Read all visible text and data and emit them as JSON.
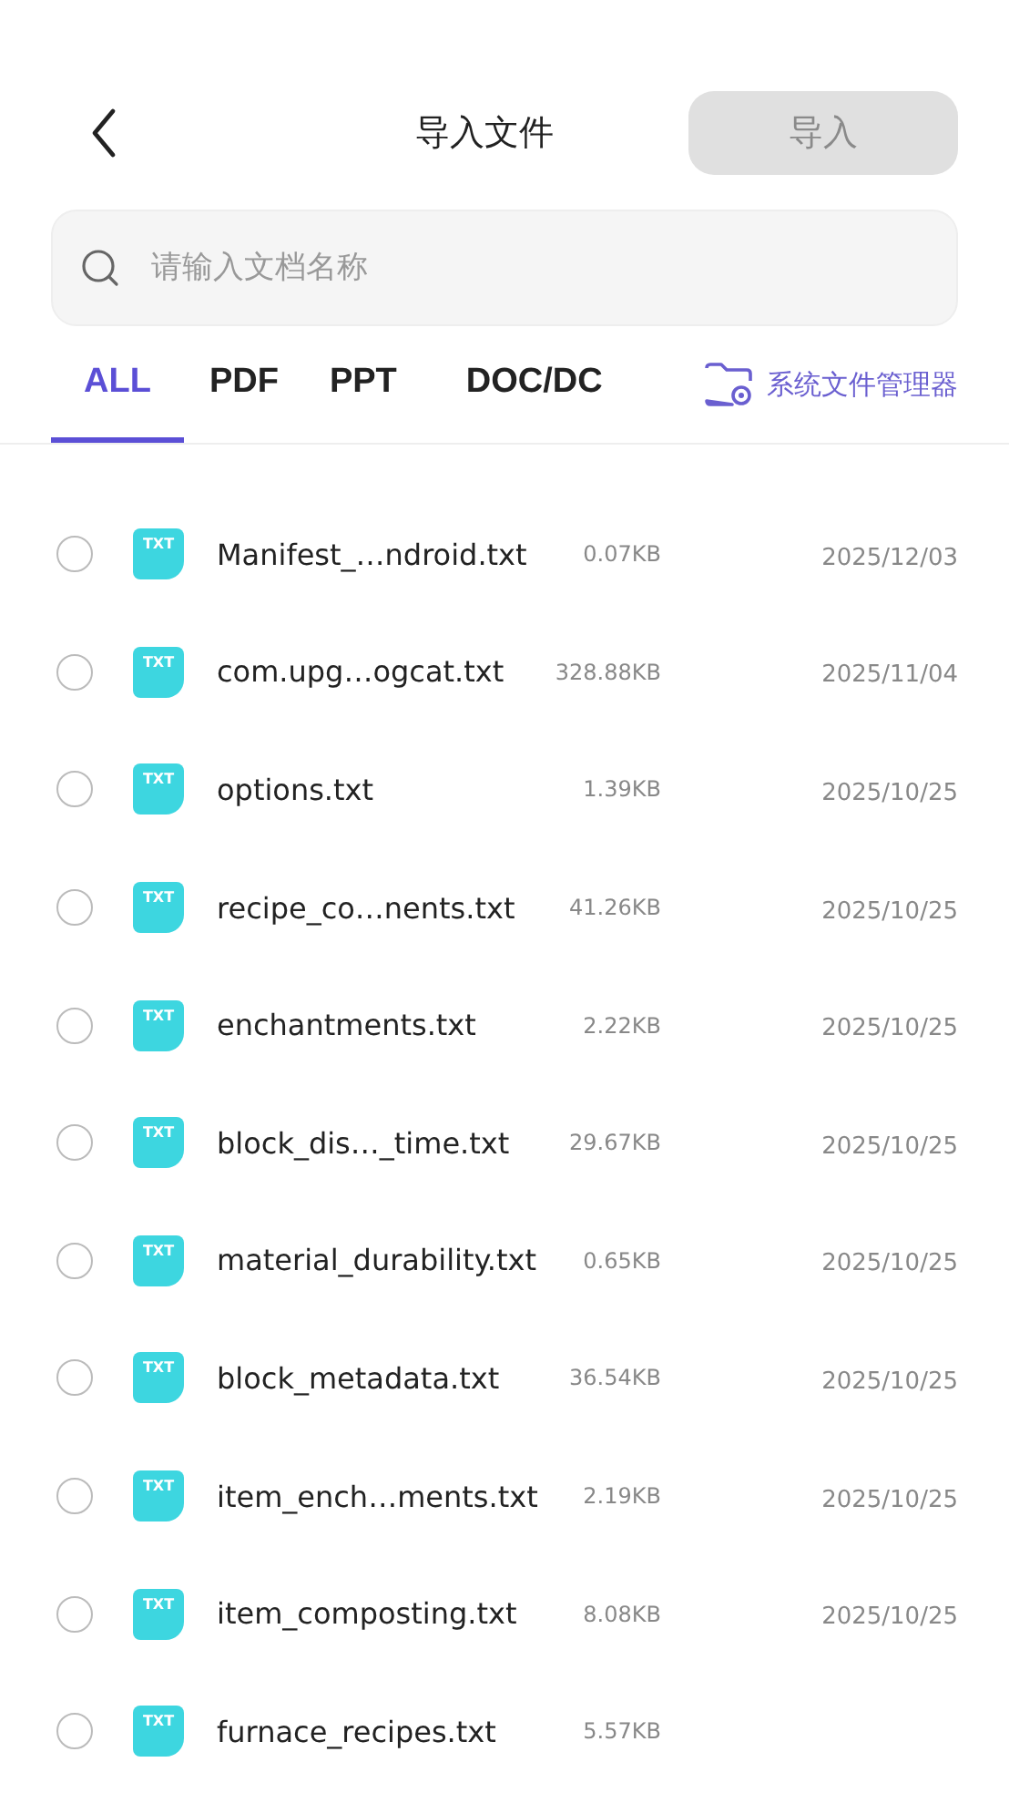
{
  "header": {
    "title": "导入文件",
    "import_button": {
      "label": "导入",
      "disabled": true
    }
  },
  "search": {
    "placeholder": "请输入文档名称"
  },
  "tabs": [
    {
      "label": "ALL",
      "selected": true
    },
    {
      "label": "PDF",
      "selected": false
    },
    {
      "label": "PPT",
      "selected": false
    },
    {
      "label": "DOC/DC",
      "selected": false
    }
  ],
  "file_manager_link": "系统文件管理器",
  "files": [
    {
      "type": "TXT",
      "name": "Manifest_…ndroid.txt",
      "size": "0.07KB",
      "date": "2025/12/03",
      "checked": false
    },
    {
      "type": "TXT",
      "name": "com.upg…ogcat.txt",
      "size": "328.88KB",
      "date": "2025/11/04",
      "checked": false
    },
    {
      "type": "TXT",
      "name": "options.txt",
      "size": "1.39KB",
      "date": "2025/10/25",
      "checked": false
    },
    {
      "type": "TXT",
      "name": "recipe_co…nents.txt",
      "size": "41.26KB",
      "date": "2025/10/25",
      "checked": false
    },
    {
      "type": "TXT",
      "name": "enchantments.txt",
      "size": "2.22KB",
      "date": "2025/10/25",
      "checked": false
    },
    {
      "type": "TXT",
      "name": "block_dis…_time.txt",
      "size": "29.67KB",
      "date": "2025/10/25",
      "checked": false
    },
    {
      "type": "TXT",
      "name": "material_durability.txt",
      "size": "0.65KB",
      "date": "2025/10/25",
      "checked": false
    },
    {
      "type": "TXT",
      "name": "block_metadata.txt",
      "size": "36.54KB",
      "date": "2025/10/25",
      "checked": false
    },
    {
      "type": "TXT",
      "name": "item_ench…ments.txt",
      "size": "2.19KB",
      "date": "2025/10/25",
      "checked": false
    },
    {
      "type": "TXT",
      "name": "item_composting.txt",
      "size": "8.08KB",
      "date": "2025/10/25",
      "checked": false
    },
    {
      "type": "TXT",
      "name": "furnace_recipes.txt",
      "size": "5.57KB",
      "checked": false
    }
  ]
}
